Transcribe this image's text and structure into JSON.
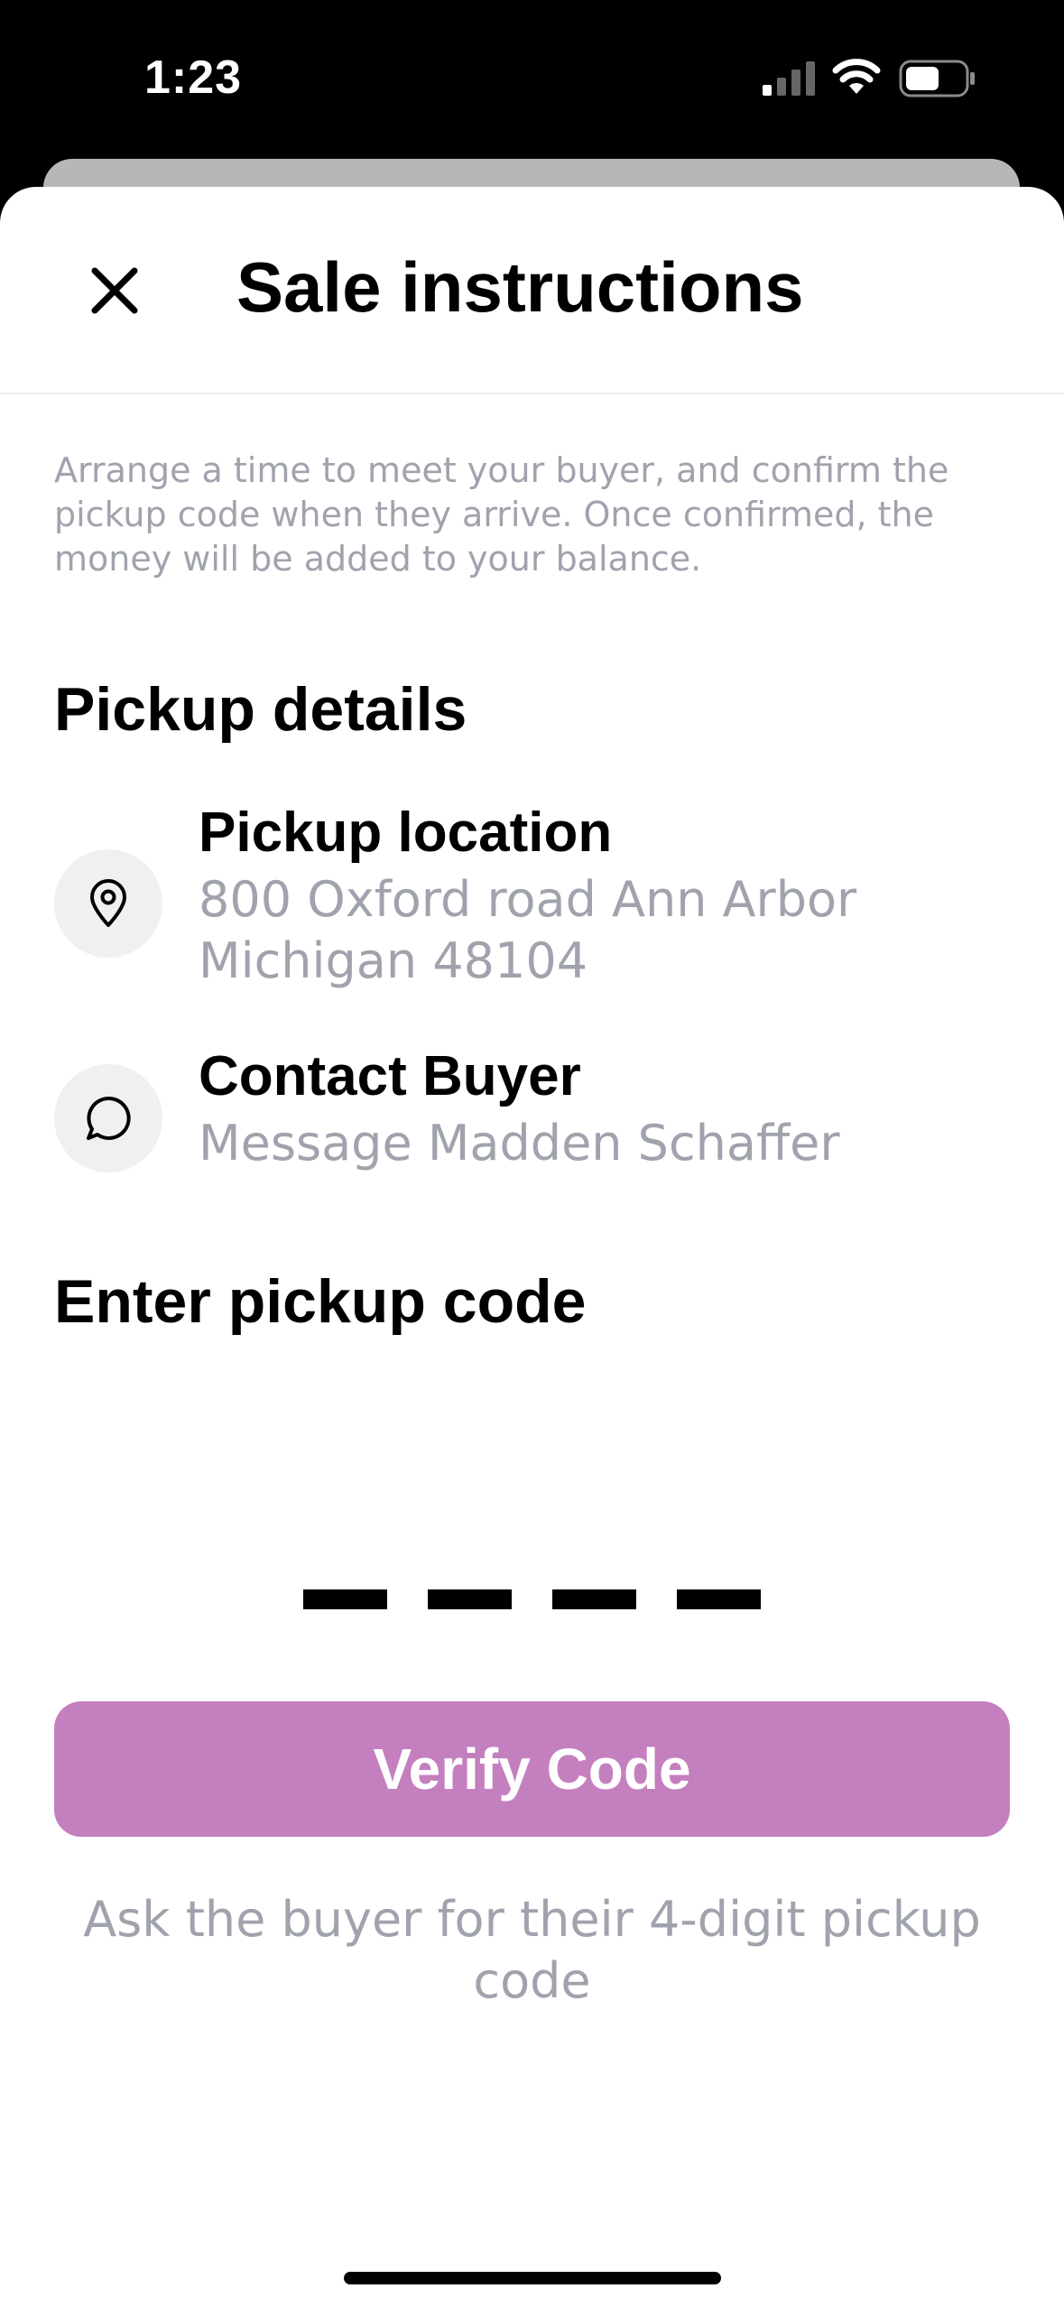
{
  "status_bar": {
    "time": "1:23",
    "icons": [
      "cellular-signal-icon",
      "wifi-icon",
      "battery-icon"
    ]
  },
  "header": {
    "close_icon": "close-icon",
    "title": "Sale instructions"
  },
  "intro": "Arrange a time to meet your buyer, and confirm the pickup code when they arrive. Once confirmed, the money will be added to your balance.",
  "pickup_details": {
    "title": "Pickup details",
    "location": {
      "icon": "map-pin-icon",
      "label": "Pickup location",
      "value": "800 Oxford road Ann Arbor Michigan 48104"
    },
    "contact": {
      "icon": "chat-bubble-icon",
      "label": "Contact Buyer",
      "value": "Message Madden Schaffer"
    }
  },
  "pickup_code": {
    "title": "Enter pickup code",
    "digits": 4
  },
  "verify_button": "Verify Code",
  "hint": "Ask the buyer for their 4-digit pickup code",
  "colors": {
    "accent": "#c47fbf",
    "muted_text": "#a0a3ad",
    "icon_circle_bg": "#f0f0f0"
  }
}
